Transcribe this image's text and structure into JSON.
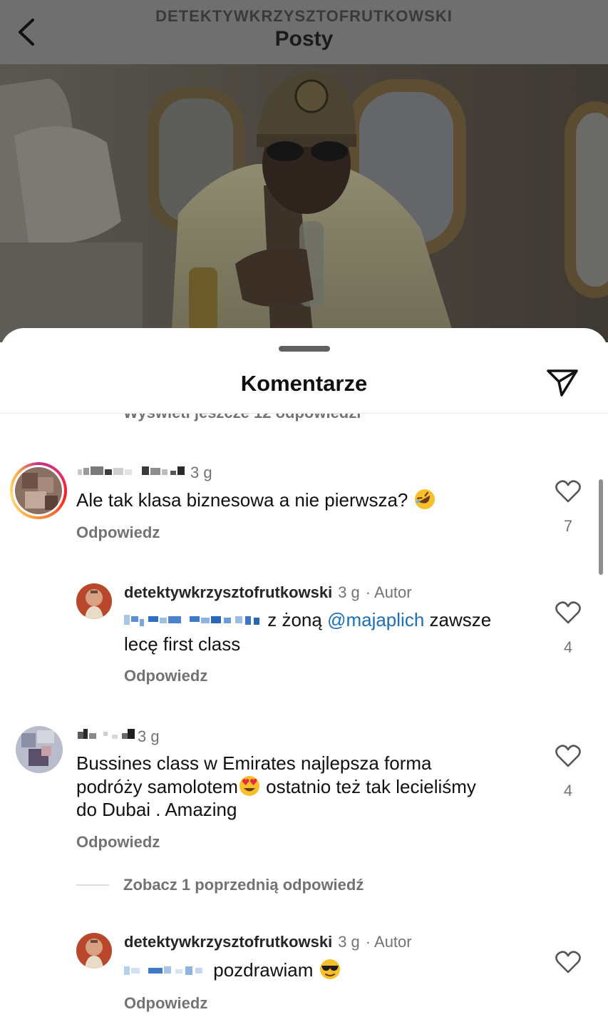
{
  "header": {
    "username": "DETEKTYWKRZYSZTOFRUTKOWSKI",
    "title": "Posty"
  },
  "sheet": {
    "title": "Komentarze",
    "partial_view_more": "Wyświetl jeszcze 12 odpowiedzi"
  },
  "comments": [
    {
      "time": "3 g",
      "text": "Ale tak klasa biznesowa a nie pierwsza?",
      "emoji": "rolling-on-floor-laughing-emoji",
      "reply": "Odpowiedz",
      "likes": "7"
    },
    {
      "username": "detektywkrzysztofrutkowski",
      "time": "3 g",
      "author_tag": "· Autor",
      "text_a": " z żoną ",
      "mention": "@majaplich",
      "text_b": " zawsze",
      "text_c": "lecę first class",
      "reply": "Odpowiedz",
      "likes": "4"
    },
    {
      "time": "3 g",
      "line1": "Bussines class w Emirates najlepsza forma",
      "line2a": "podróży samolotem",
      "emoji": "heart-eyes-emoji",
      "line2b": " ostatnio też tak lecieliśmy",
      "line3": "do Dubai . Amazing",
      "reply": "Odpowiedz",
      "likes": "4"
    },
    {
      "view_previous": "Zobacz 1 poprzednią odpowiedź"
    },
    {
      "username": "detektywkrzysztofrutkowski",
      "time": "3 g",
      "author_tag": "· Autor",
      "text": "pozdrawiam",
      "emoji": "sunglasses-emoji",
      "reply": "Odpowiedz"
    }
  ]
}
